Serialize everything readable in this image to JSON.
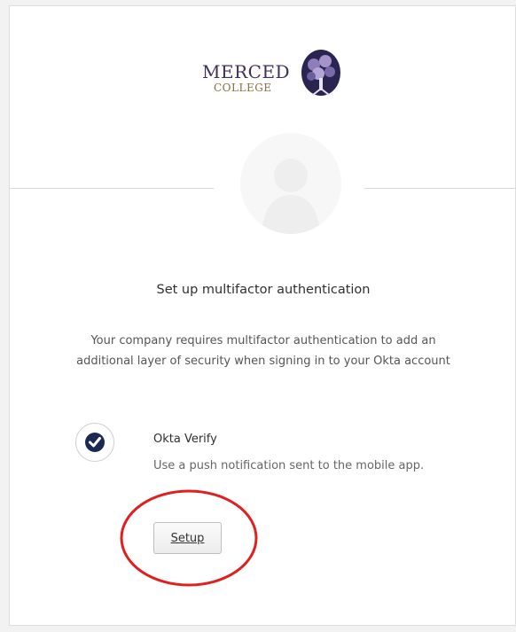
{
  "logo": {
    "line1": "MERCED",
    "line2": "COLLEGE",
    "emblem_icon": "tree-emblem-icon"
  },
  "avatar": {
    "icon": "user-silhouette-icon"
  },
  "headline": "Set up multifactor authentication",
  "description": "Your company requires multifactor authentication to add an additional layer of security when signing in to your Okta account",
  "factor": {
    "icon": "okta-verify-check-icon",
    "title": "Okta Verify",
    "description": "Use a push notification sent to the mobile app.",
    "setup_label": "Setup"
  },
  "colors": {
    "annotation_circle": "#e02020",
    "okta_icon": "#1c2a52",
    "logo_purple": "#3e2e5e",
    "logo_gold": "#8a6d3b"
  }
}
